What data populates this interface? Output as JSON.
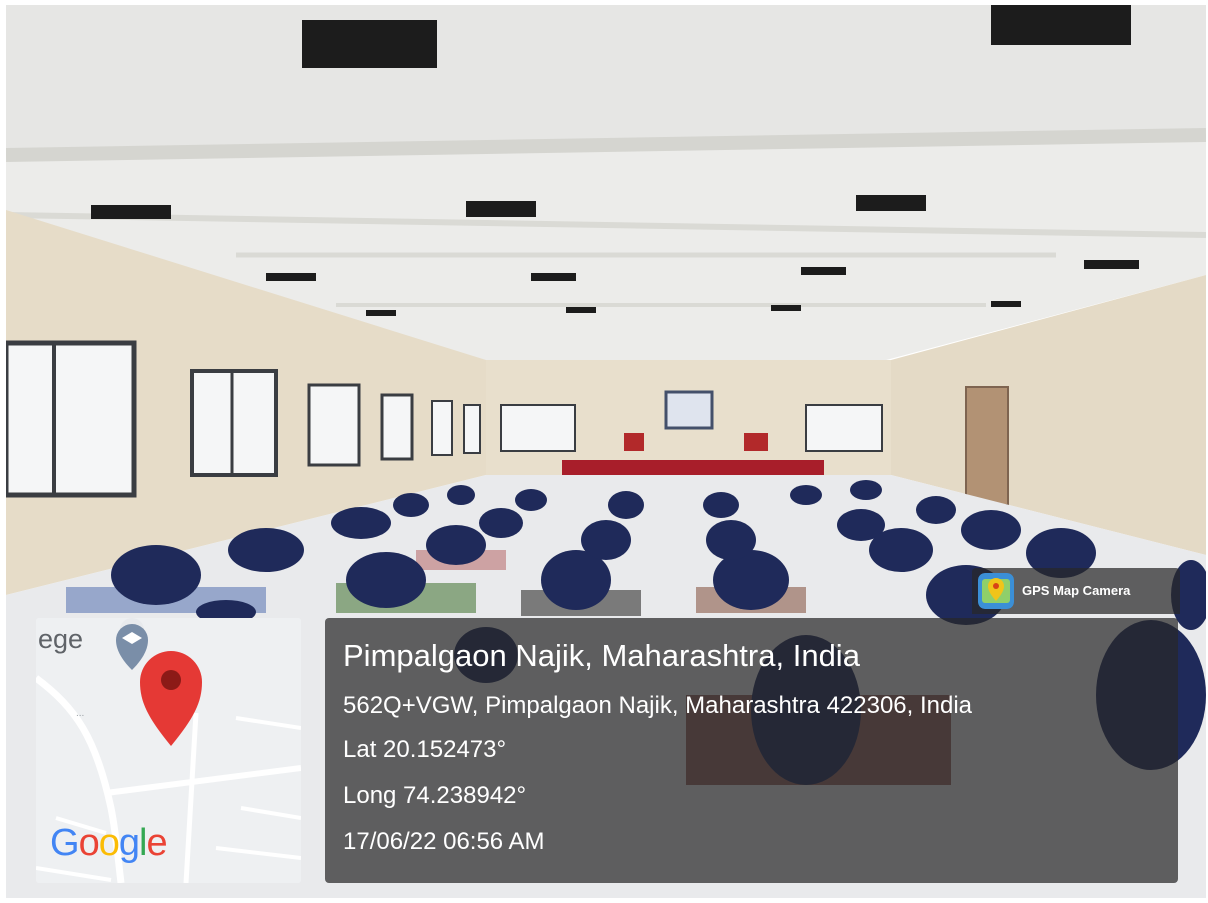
{
  "photo": {
    "subject": "indoor-hall-yoga-session"
  },
  "map": {
    "label": "ege",
    "logo": [
      "G",
      "o",
      "o",
      "g",
      "l",
      "e"
    ],
    "pin_color": "#e53935"
  },
  "overlay": {
    "camera_badge": "GPS Map Camera",
    "location_title": "Pimpalgaon Najik, Maharashtra, India",
    "address": "562Q+VGW, Pimpalgaon Najik, Maharashtra 422306, India",
    "latitude": "Lat 20.152473°",
    "longitude": "Long 74.238942°",
    "datetime": "17/06/22 06:56 AM"
  }
}
